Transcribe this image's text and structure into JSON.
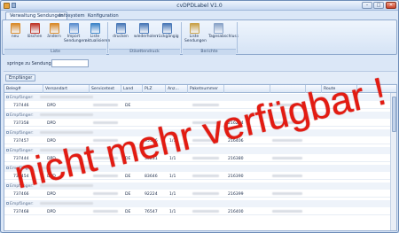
{
  "window": {
    "title": "cvDPDLabel V1.0",
    "controls": {
      "minimize": "–",
      "maximize": "□",
      "close": "✕"
    }
  },
  "tabs": [
    "Verwaltung Sendungen",
    "Infosystem",
    "Konfiguration"
  ],
  "ribbon": {
    "groups": [
      {
        "label": "Liste",
        "buttons": [
          {
            "label": "neu",
            "icon": "new-icon",
            "color": "#d98b2b"
          },
          {
            "label": "löschen",
            "icon": "delete-icon",
            "color": "#c0392b"
          },
          {
            "label": "ändern",
            "icon": "edit-icon",
            "color": "#d98b2b"
          },
          {
            "label": "Import Sendungen",
            "icon": "import-icon",
            "color": "#5d8fcf"
          },
          {
            "label": "Liste aktualisieren",
            "icon": "refresh-list-icon",
            "color": "#3f86c9"
          }
        ]
      },
      {
        "label": "Etikettendruck",
        "buttons": [
          {
            "label": "drucken",
            "icon": "print-icon",
            "color": "#4a79b8"
          },
          {
            "label": "wiederholen",
            "icon": "repeat-print-icon",
            "color": "#4a79b8"
          },
          {
            "label": "rückgängig",
            "icon": "undo-icon",
            "color": "#4a79b8"
          }
        ]
      },
      {
        "label": "Berichte",
        "buttons": [
          {
            "label": "Liste Sendungen",
            "icon": "report-list-icon",
            "color": "#c9a24a"
          },
          {
            "label": "Tagesabschluss",
            "icon": "daily-closing-icon",
            "color": "#8aa4c8"
          }
        ]
      }
    ]
  },
  "jump": {
    "label": "springe zu Sendung:",
    "value": ""
  },
  "group_button": {
    "label": "Empfänger"
  },
  "grid": {
    "columns": [
      "Beleg#",
      "Versandart",
      "Servicetext",
      "Land",
      "PLZ",
      "Anz...",
      "Paketnummer",
      "",
      "",
      "",
      "Route"
    ],
    "rows": [
      {
        "type": "group",
        "label": "Empfänger:"
      },
      {
        "type": "data",
        "beleg": "737446",
        "versandart": "DPD",
        "land": "DE",
        "plz": "",
        "anz": "",
        "paket": ""
      },
      {
        "type": "group",
        "label": "Empfänger:"
      },
      {
        "type": "data",
        "beleg": "737358",
        "versandart": "DPD",
        "land": "",
        "plz": "",
        "anz": "",
        "paket": "216294"
      },
      {
        "type": "group",
        "label": "Empfänger:"
      },
      {
        "type": "data",
        "beleg": "737457",
        "versandart": "DPD",
        "land": "",
        "plz": "95326",
        "anz": "1/1",
        "paket": "216406"
      },
      {
        "type": "group",
        "label": "Empfänger:"
      },
      {
        "type": "data",
        "beleg": "737444",
        "versandart": "DPD",
        "land": "DE",
        "plz": "36231",
        "anz": "1/1",
        "paket": "216380"
      },
      {
        "type": "group",
        "label": "Empfänger:"
      },
      {
        "type": "data",
        "beleg": "737454",
        "versandart": "DPD",
        "land": "DE",
        "plz": "83646",
        "anz": "1/1",
        "paket": "216390"
      },
      {
        "type": "group",
        "label": "Empfänger:"
      },
      {
        "type": "data",
        "beleg": "737466",
        "versandart": "DPD",
        "land": "DE",
        "plz": "92224",
        "anz": "1/1",
        "paket": "216399"
      },
      {
        "type": "group",
        "label": "Empfänger:"
      },
      {
        "type": "data",
        "beleg": "737468",
        "versandart": "DPD",
        "land": "DE",
        "plz": "76547",
        "anz": "1/1",
        "paket": "216400"
      }
    ]
  },
  "overlay": {
    "text": "nicht mehr verfügbar !",
    "color": "#e31b12"
  }
}
